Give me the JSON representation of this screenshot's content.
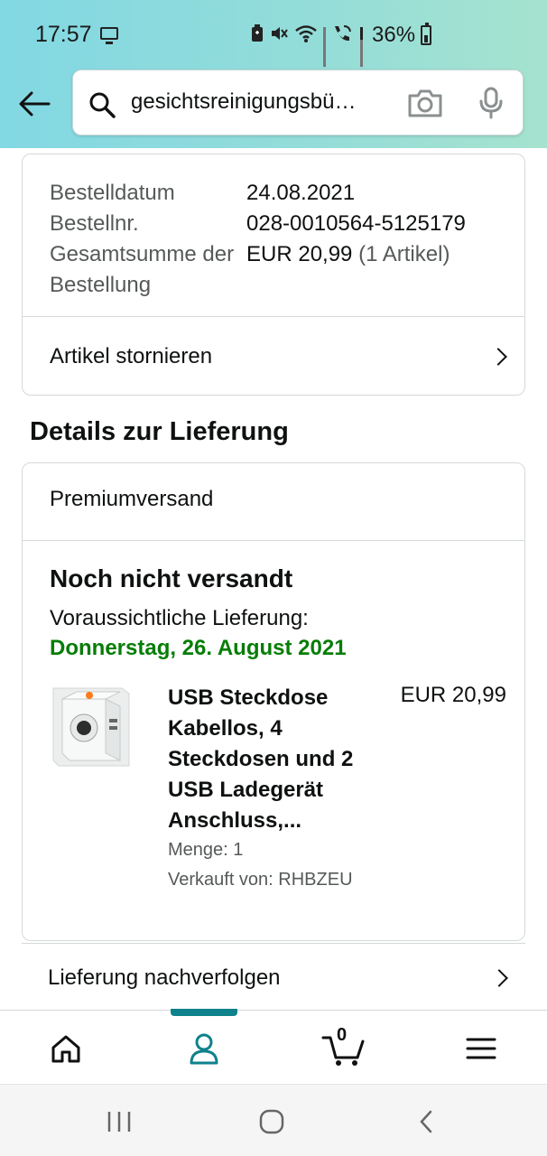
{
  "status_bar": {
    "time": "17:57",
    "battery": "36%",
    "icons": [
      "screen-mirror-icon",
      "battery-saver-icon",
      "mute-icon",
      "wifi-icon",
      "signal-icon",
      "volte-call-icon",
      "signal-icon",
      "battery-icon"
    ]
  },
  "search": {
    "query": "gesichtsreinigungsbü…"
  },
  "order": {
    "rows": [
      {
        "label": "Bestelldatum",
        "value": "24.08.2021",
        "extra": ""
      },
      {
        "label": "Bestellnr.",
        "value": "028-0010564-5125179",
        "extra": ""
      },
      {
        "label": "Gesamtsumme der Bestellung",
        "value": "EUR 20,99",
        "extra": "(1 Artikel)"
      }
    ],
    "cancel_label": "Artikel stornieren"
  },
  "delivery": {
    "section_title": "Details zur Lieferung",
    "shipping_method": "Premiumversand",
    "status": "Noch nicht versandt",
    "eta_label": "Voraussichtliche Lieferung:",
    "eta_date": "Donnerstag, 26. August 2021",
    "product": {
      "title": "USB Steckdose Kabellos, 4 Steckdosen und 2 USB Ladegerät Anschluss,...",
      "price": "EUR 20,99",
      "quantity": "Menge: 1",
      "seller": "Verkauft von: RHBZEU"
    },
    "track_label": "Lieferung nachverfolgen"
  },
  "bottom_nav": {
    "items": [
      "home-icon",
      "account-icon",
      "cart-icon",
      "menu-icon"
    ],
    "cart_count": "0",
    "active_color": "#0f828c"
  },
  "colors": {
    "eta_green": "#067d06",
    "accent_teal": "#0f828c"
  }
}
